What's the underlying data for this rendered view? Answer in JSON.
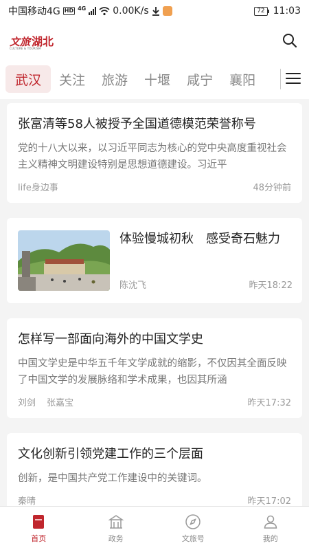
{
  "status_bar": {
    "carrier": "中国移动4G",
    "hd_badge": "HD",
    "network": "4G",
    "speed": "0.00K/s",
    "battery": "72",
    "time": "11:03"
  },
  "header": {
    "logo_text_a": "文旅",
    "logo_text_b": "湖北",
    "logo_sub": "CULTURE & TOURISM",
    "search_icon": "search-icon"
  },
  "tabs": [
    {
      "label": "武汉",
      "active": true
    },
    {
      "label": "关注"
    },
    {
      "label": "旅游"
    },
    {
      "label": "十堰"
    },
    {
      "label": "咸宁"
    },
    {
      "label": "襄阳"
    }
  ],
  "feed": [
    {
      "title": "张富清等58人被授予全国道德模范荣誉称号",
      "desc": "党的十八大以来，以习近平同志为核心的党中央高度重视社会主义精神文明建设特别是思想道德建设。习近平",
      "authors": [
        "life身边事"
      ],
      "time": "48分钟前"
    },
    {
      "title": "体验慢城初秋　感受奇石魅力",
      "authors": [
        "陈沈飞"
      ],
      "time": "昨天18:22",
      "has_image": true
    },
    {
      "title": "怎样写一部面向海外的中国文学史",
      "desc": "中国文学史是中华五千年文学成就的缩影，不仅因其全面反映了中国文学的发展脉络和学术成果，也因其所涵",
      "authors": [
        "刘剑",
        "张嘉宝"
      ],
      "time": "昨天17:32"
    },
    {
      "title": "文化创新引领党建工作的三个层面",
      "desc": "创新，是中国共产党工作建设中的关键词。",
      "authors": [
        "秦晴"
      ],
      "time": "昨天17:02"
    }
  ],
  "bottom_nav": [
    {
      "label": "首页",
      "icon": "home-icon",
      "active": true
    },
    {
      "label": "政务",
      "icon": "government-building-icon"
    },
    {
      "label": "文旅号",
      "icon": "compass-icon"
    },
    {
      "label": "我的",
      "icon": "user-icon"
    }
  ],
  "colors": {
    "accent": "#c0262d",
    "tab_active_bg": "#f7e9e9"
  }
}
